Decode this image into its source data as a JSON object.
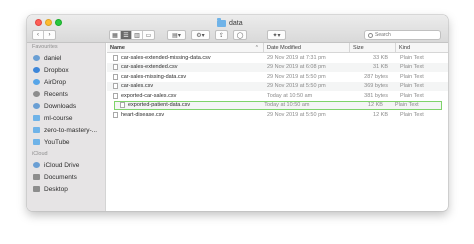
{
  "window": {
    "title": "data"
  },
  "toolbar": {
    "back_label": "‹",
    "forward_label": "›",
    "view_icons": [
      "icons-view-icon",
      "list-view-icon",
      "columns-view-icon",
      "gallery-view-icon"
    ],
    "group_icon": "group-icon",
    "action_icon": "gear-icon",
    "share_icon": "share-icon",
    "tag_icon": "tag-icon",
    "dropbox_icon": "dropbox-icon",
    "search": {
      "placeholder": "Search",
      "value": ""
    }
  },
  "sidebar": {
    "favourites_heading": "Favourites",
    "favourites": [
      {
        "label": "daniel",
        "icon": "home-icon",
        "color": "#6a9fd4"
      },
      {
        "label": "Dropbox",
        "icon": "dropbox-icon",
        "color": "#3d86d9"
      },
      {
        "label": "AirDrop",
        "icon": "airdrop-icon",
        "color": "#57a5e8"
      },
      {
        "label": "Recents",
        "icon": "clock-icon",
        "color": "#8d8d8d"
      },
      {
        "label": "Downloads",
        "icon": "download-icon",
        "color": "#6a9fd4"
      },
      {
        "label": "ml-course",
        "icon": "folder-icon",
        "color": "#6fb3e8"
      },
      {
        "label": "zero-to-mastery-...",
        "icon": "folder-icon",
        "color": "#6fb3e8"
      },
      {
        "label": "YouTube",
        "icon": "folder-icon",
        "color": "#6fb3e8"
      }
    ],
    "icloud_heading": "iCloud",
    "icloud": [
      {
        "label": "iCloud Drive",
        "icon": "cloud-icon",
        "color": "#6a9fd4"
      },
      {
        "label": "Documents",
        "icon": "document-icon",
        "color": "#8d8d8d"
      },
      {
        "label": "Desktop",
        "icon": "desktop-icon",
        "color": "#8d8d8d"
      }
    ]
  },
  "columns": {
    "name": "Name",
    "date": "Date Modified",
    "size": "Size",
    "kind": "Kind"
  },
  "files": [
    {
      "name": "car-sales-extended-missing-data.csv",
      "date": "29 Nov 2019 at 7:31 pm",
      "size": "33 KB",
      "kind": "Plain Text"
    },
    {
      "name": "car-sales-extended.csv",
      "date": "29 Nov 2019 at 6:08 pm",
      "size": "31 KB",
      "kind": "Plain Text"
    },
    {
      "name": "car-sales-missing-data.csv",
      "date": "29 Nov 2019 at 5:50 pm",
      "size": "287 bytes",
      "kind": "Plain Text"
    },
    {
      "name": "car-sales.csv",
      "date": "29 Nov 2019 at 5:50 pm",
      "size": "369 bytes",
      "kind": "Plain Text"
    },
    {
      "name": "exported-car-sales.csv",
      "date": "Today at 10:50 am",
      "size": "381 bytes",
      "kind": "Plain Text"
    },
    {
      "name": "exported-patient-data.csv",
      "date": "Today at 10:50 am",
      "size": "12 KB",
      "kind": "Plain Text",
      "highlighted": true
    },
    {
      "name": "heart-disease.csv",
      "date": "29 Nov 2019 at 5:50 pm",
      "size": "12 KB",
      "kind": "Plain Text"
    }
  ],
  "highlight_color": "#7fd36a"
}
